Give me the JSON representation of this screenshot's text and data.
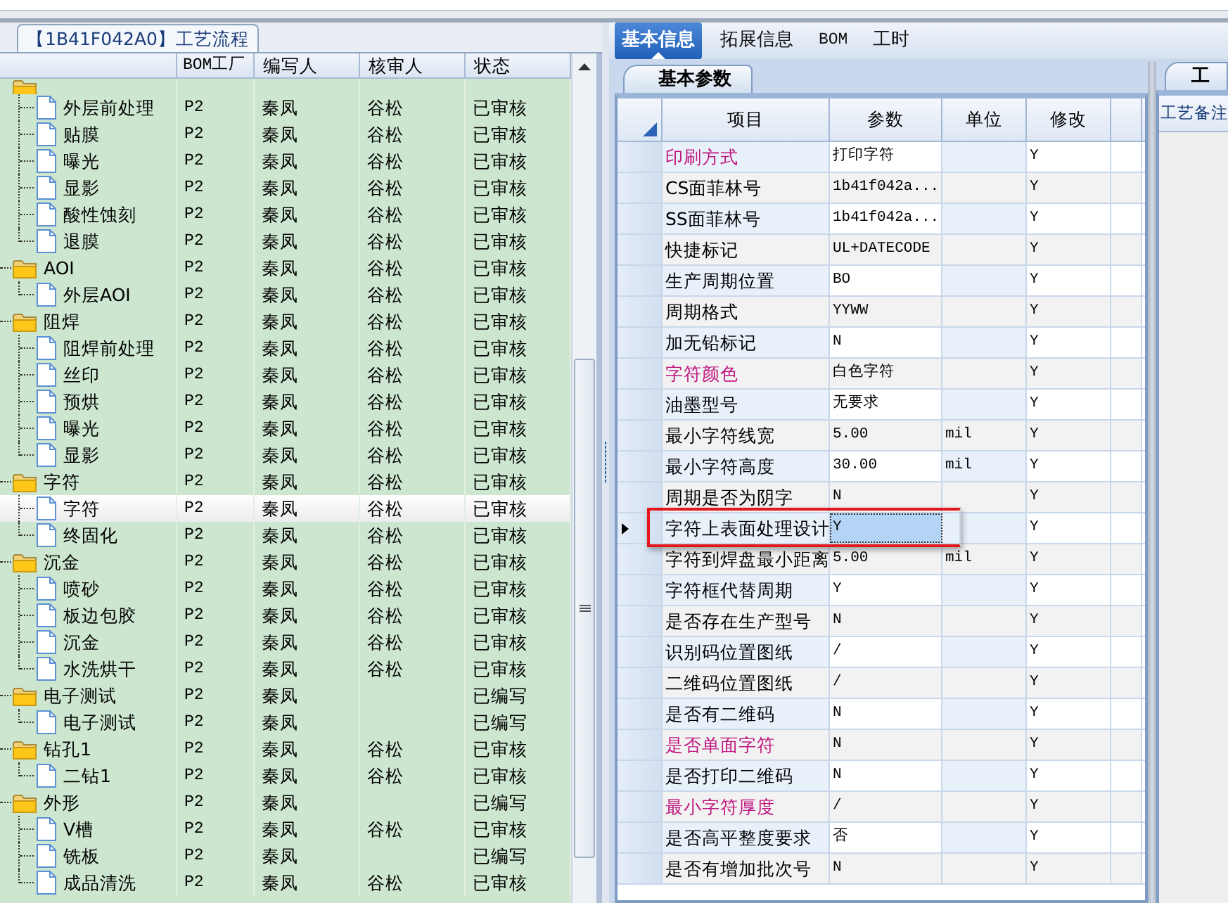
{
  "left_panel": {
    "tab": "【1B41F042A0】工艺流程",
    "columns": [
      "BOM工厂",
      "编写人",
      "核审人",
      "状态"
    ],
    "tree": [
      {
        "kind": "folder",
        "selected": false,
        "children": [
          {
            "kind": "file",
            "label": "外层前处理",
            "bom": "P2",
            "author": "秦凤",
            "reviewer": "谷松",
            "status": "已审核",
            "selected": false
          },
          {
            "kind": "file",
            "label": "贴膜",
            "bom": "P2",
            "author": "秦凤",
            "reviewer": "谷松",
            "status": "已审核",
            "selected": false
          },
          {
            "kind": "file",
            "label": "曝光",
            "bom": "P2",
            "author": "秦凤",
            "reviewer": "谷松",
            "status": "已审核",
            "selected": false
          },
          {
            "kind": "file",
            "label": "显影",
            "bom": "P2",
            "author": "秦凤",
            "reviewer": "谷松",
            "status": "已审核",
            "selected": false
          },
          {
            "kind": "file",
            "label": "酸性蚀刻",
            "bom": "P2",
            "author": "秦凤",
            "reviewer": "谷松",
            "status": "已审核",
            "selected": false
          },
          {
            "kind": "file",
            "label": "退膜",
            "bom": "P2",
            "author": "秦凤",
            "reviewer": "谷松",
            "status": "已审核",
            "selected": false
          }
        ]
      },
      {
        "kind": "folder",
        "label": "AOI",
        "bom": "P2",
        "author": "秦凤",
        "reviewer": "谷松",
        "status": "已审核",
        "selected": false,
        "children": [
          {
            "kind": "file",
            "label": "外层AOI",
            "bom": "P2",
            "author": "秦凤",
            "reviewer": "谷松",
            "status": "已审核",
            "selected": false
          }
        ]
      },
      {
        "kind": "folder",
        "label": "阻焊",
        "bom": "P2",
        "author": "秦凤",
        "reviewer": "谷松",
        "status": "已审核",
        "selected": false,
        "children": [
          {
            "kind": "file",
            "label": "阻焊前处理",
            "bom": "P2",
            "author": "秦凤",
            "reviewer": "谷松",
            "status": "已审核",
            "selected": false
          },
          {
            "kind": "file",
            "label": "丝印",
            "bom": "P2",
            "author": "秦凤",
            "reviewer": "谷松",
            "status": "已审核",
            "selected": false
          },
          {
            "kind": "file",
            "label": "预烘",
            "bom": "P2",
            "author": "秦凤",
            "reviewer": "谷松",
            "status": "已审核",
            "selected": false
          },
          {
            "kind": "file",
            "label": "曝光",
            "bom": "P2",
            "author": "秦凤",
            "reviewer": "谷松",
            "status": "已审核",
            "selected": false
          },
          {
            "kind": "file",
            "label": "显影",
            "bom": "P2",
            "author": "秦凤",
            "reviewer": "谷松",
            "status": "已审核",
            "selected": false
          }
        ]
      },
      {
        "kind": "folder",
        "label": "字符",
        "bom": "P2",
        "author": "秦凤",
        "reviewer": "谷松",
        "status": "已审核",
        "selected": false,
        "children": [
          {
            "kind": "file",
            "label": "字符",
            "bom": "P2",
            "author": "秦凤",
            "reviewer": "谷松",
            "status": "已审核",
            "selected": true
          },
          {
            "kind": "file",
            "label": "终固化",
            "bom": "P2",
            "author": "秦凤",
            "reviewer": "谷松",
            "status": "已审核",
            "selected": false
          }
        ]
      },
      {
        "kind": "folder",
        "label": "沉金",
        "bom": "P2",
        "author": "秦凤",
        "reviewer": "谷松",
        "status": "已审核",
        "selected": false,
        "children": [
          {
            "kind": "file",
            "label": "喷砂",
            "bom": "P2",
            "author": "秦凤",
            "reviewer": "谷松",
            "status": "已审核",
            "selected": false
          },
          {
            "kind": "file",
            "label": "板边包胶",
            "bom": "P2",
            "author": "秦凤",
            "reviewer": "谷松",
            "status": "已审核",
            "selected": false
          },
          {
            "kind": "file",
            "label": "沉金",
            "bom": "P2",
            "author": "秦凤",
            "reviewer": "谷松",
            "status": "已审核",
            "selected": false
          },
          {
            "kind": "file",
            "label": "水洗烘干",
            "bom": "P2",
            "author": "秦凤",
            "reviewer": "谷松",
            "status": "已审核",
            "selected": false
          }
        ]
      },
      {
        "kind": "folder",
        "label": "电子测试",
        "bom": "P2",
        "author": "秦凤",
        "status": "已编写",
        "selected": false,
        "children": [
          {
            "kind": "file",
            "label": "电子测试",
            "bom": "P2",
            "author": "秦凤",
            "status": "已编写",
            "selected": false
          }
        ]
      },
      {
        "kind": "folder",
        "label": "钻孔1",
        "bom": "P2",
        "author": "秦凤",
        "reviewer": "谷松",
        "status": "已审核",
        "selected": false,
        "children": [
          {
            "kind": "file",
            "label": "二钻1",
            "bom": "P2",
            "author": "秦凤",
            "reviewer": "谷松",
            "status": "已审核",
            "selected": false
          }
        ]
      },
      {
        "kind": "folder",
        "label": "外形",
        "bom": "P2",
        "author": "秦凤",
        "status": "已编写",
        "selected": false,
        "children": [
          {
            "kind": "file",
            "label": "V槽",
            "bom": "P2",
            "author": "秦凤",
            "reviewer": "谷松",
            "status": "已审核",
            "selected": false
          },
          {
            "kind": "file",
            "label": "铣板",
            "bom": "P2",
            "author": "秦凤",
            "status": "已编写",
            "selected": false
          },
          {
            "kind": "file",
            "label": "成品清洗",
            "bom": "P2",
            "author": "秦凤",
            "reviewer": "谷松",
            "status": "已审核",
            "selected": false
          }
        ]
      }
    ]
  },
  "right_panel": {
    "tabs": [
      {
        "label": "基本信息",
        "selected": true
      },
      {
        "label": "拓展信息",
        "selected": false
      },
      {
        "label": "BOM",
        "selected": false
      },
      {
        "label": "工时",
        "selected": false
      }
    ],
    "section_tab": "基本参数",
    "columns": [
      "项目",
      "参数",
      "单位",
      "修改"
    ],
    "rows": [
      {
        "item": "印刷方式",
        "value": "打印字符",
        "modify": "Y",
        "emphasis": true,
        "selected": false,
        "marked": false
      },
      {
        "item": "CS面菲林号",
        "value": "1b41f042a...",
        "modify": "Y",
        "emphasis": false,
        "selected": false,
        "marked": false
      },
      {
        "item": "SS面菲林号",
        "value": "1b41f042a...",
        "modify": "Y",
        "emphasis": false,
        "selected": false,
        "marked": false
      },
      {
        "item": "快捷标记",
        "value": "UL+DATECODE",
        "modify": "Y",
        "emphasis": false,
        "selected": false,
        "marked": false
      },
      {
        "item": "生产周期位置",
        "value": "BO",
        "modify": "Y",
        "emphasis": false,
        "selected": false,
        "marked": false
      },
      {
        "item": "周期格式",
        "value": "YYWW",
        "modify": "Y",
        "emphasis": false,
        "selected": false,
        "marked": false
      },
      {
        "item": "加无铅标记",
        "value": "N",
        "modify": "Y",
        "emphasis": false,
        "selected": false,
        "marked": false
      },
      {
        "item": "字符颜色",
        "value": "白色字符",
        "modify": "Y",
        "emphasis": true,
        "selected": false,
        "marked": false
      },
      {
        "item": "油墨型号",
        "value": "无要求",
        "modify": "Y",
        "emphasis": false,
        "selected": false,
        "marked": false
      },
      {
        "item": "最小字符线宽",
        "value": "5.00",
        "unit": "mil",
        "modify": "Y",
        "emphasis": false,
        "selected": false,
        "marked": false
      },
      {
        "item": "最小字符高度",
        "value": "30.00",
        "unit": "mil",
        "modify": "Y",
        "emphasis": false,
        "selected": false,
        "marked": false
      },
      {
        "item": "周期是否为阴字",
        "value": "N",
        "modify": "Y",
        "emphasis": false,
        "selected": false,
        "marked": false
      },
      {
        "item": "字符上表面处理设计",
        "value": "Y",
        "modify": "Y",
        "emphasis": false,
        "selected": true,
        "marked": true
      },
      {
        "item": "字符到焊盘最小距离",
        "value": "5.00",
        "unit": "mil",
        "modify": "Y",
        "emphasis": false,
        "selected": false,
        "marked": false
      },
      {
        "item": "字符框代替周期",
        "value": "Y",
        "modify": "Y",
        "emphasis": false,
        "selected": false,
        "marked": false
      },
      {
        "item": "是否存在生产型号",
        "value": "N",
        "modify": "Y",
        "emphasis": false,
        "selected": false,
        "marked": false
      },
      {
        "item": "识别码位置图纸",
        "value": "/",
        "modify": "Y",
        "emphasis": false,
        "selected": false,
        "marked": false
      },
      {
        "item": "二维码位置图纸",
        "value": "/",
        "modify": "Y",
        "emphasis": false,
        "selected": false,
        "marked": false
      },
      {
        "item": "是否有二维码",
        "value": "N",
        "modify": "Y",
        "emphasis": false,
        "selected": false,
        "marked": false
      },
      {
        "item": "是否单面字符",
        "value": "N",
        "modify": "Y",
        "emphasis": true,
        "selected": false,
        "marked": false
      },
      {
        "item": "是否打印二维码",
        "value": "N",
        "modify": "Y",
        "emphasis": false,
        "selected": false,
        "marked": false
      },
      {
        "item": "最小字符厚度",
        "value": "/",
        "modify": "Y",
        "emphasis": true,
        "selected": false,
        "marked": false
      },
      {
        "item": "是否高平整度要求",
        "value": "否",
        "modify": "Y",
        "emphasis": false,
        "selected": false,
        "marked": false
      },
      {
        "item": "是否有增加批次号",
        "value": "N",
        "modify": "Y",
        "emphasis": false,
        "selected": false,
        "marked": false
      }
    ]
  },
  "notes_panel": {
    "tab": "工",
    "header": "工艺备注"
  }
}
